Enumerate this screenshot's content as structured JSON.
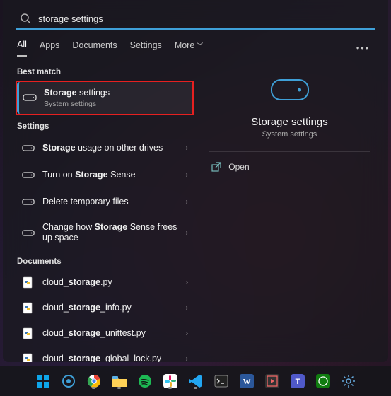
{
  "search": {
    "query": "storage settings"
  },
  "tabs": {
    "all": "All",
    "apps": "Apps",
    "documents": "Documents",
    "settings": "Settings",
    "more": "More"
  },
  "sections": {
    "best_match": "Best match",
    "settings": "Settings",
    "documents": "Documents"
  },
  "results": {
    "best_match": {
      "title_pre": "Storage",
      "title_post": " settings",
      "subtitle": "System settings"
    },
    "settings": [
      {
        "title_html": "<b>Storage</b> usage on other drives"
      },
      {
        "title_html": "Turn on <b>Storage</b> Sense"
      },
      {
        "title_html": "Delete temporary files"
      },
      {
        "title_html": "Change how <b>Storage</b> Sense frees up space"
      }
    ],
    "documents": [
      {
        "name_html": "cloud_<b>storage</b>.py"
      },
      {
        "name_html": "cloud_<b>storage</b>_info.py"
      },
      {
        "name_html": "cloud_<b>storage</b>_unittest.py"
      },
      {
        "name_html": "cloud_<b>storage</b>_global_lock.py"
      }
    ]
  },
  "detail": {
    "title": "Storage settings",
    "subtitle": "System settings",
    "open": "Open"
  },
  "taskbar_items": [
    "start",
    "cast",
    "chrome",
    "explorer",
    "spotify",
    "slack",
    "vscode",
    "terminal",
    "word",
    "media",
    "teams",
    "xbox",
    "settings"
  ]
}
